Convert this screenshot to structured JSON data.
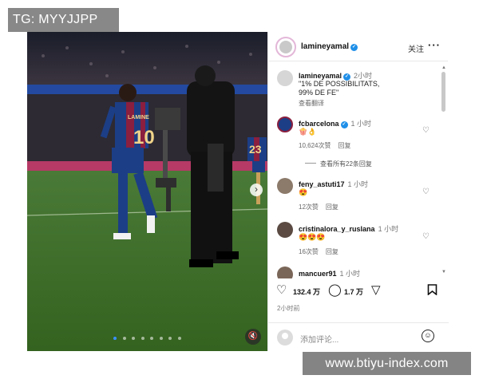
{
  "watermark_top": "TG: MYYJJPP",
  "watermark_bottom": "www.btiyu-index.com",
  "post": {
    "author": "lamineyamal",
    "follow_label": "关注",
    "more_label": "···",
    "caption_author": "lamineyamal",
    "caption_time": "2小时",
    "caption_line1": "\"1% DE POSSIBILITATS,",
    "caption_line2": "99% DE FE\"",
    "see_translation": "查看翻译",
    "photo_shirt_text": "LAMINE",
    "photo_number": "10",
    "photo_bg_number": "23"
  },
  "comments": [
    {
      "user": "fcbarcelona",
      "time": "1 小时",
      "text": "🍿👌",
      "likes": "10,624次赞",
      "reply": "回复",
      "verified": true
    },
    {
      "user": "feny_astuti17",
      "time": "1 小时",
      "text": "😍",
      "likes": "12次赞",
      "reply": "回复"
    },
    {
      "user": "cristinalora_y_ruslana",
      "time": "1 小时",
      "text": "😍😍😍",
      "likes": "16次赞",
      "reply": "回复"
    },
    {
      "user": "mancuer91",
      "time": "1 小时"
    }
  ],
  "see_replies": "查看所有22条回复",
  "actions": {
    "likes": "132.4 万",
    "comments": "1.7 万"
  },
  "posted_time": "2小时前",
  "add_comment_placeholder": "添加评论...",
  "colors": {
    "verified": "#1f8fe8",
    "active_dot": "#3a8fff",
    "pitch": "#3c6a2b",
    "kit_blue": "#1c3e86",
    "kit_red": "#8a1f3f"
  }
}
